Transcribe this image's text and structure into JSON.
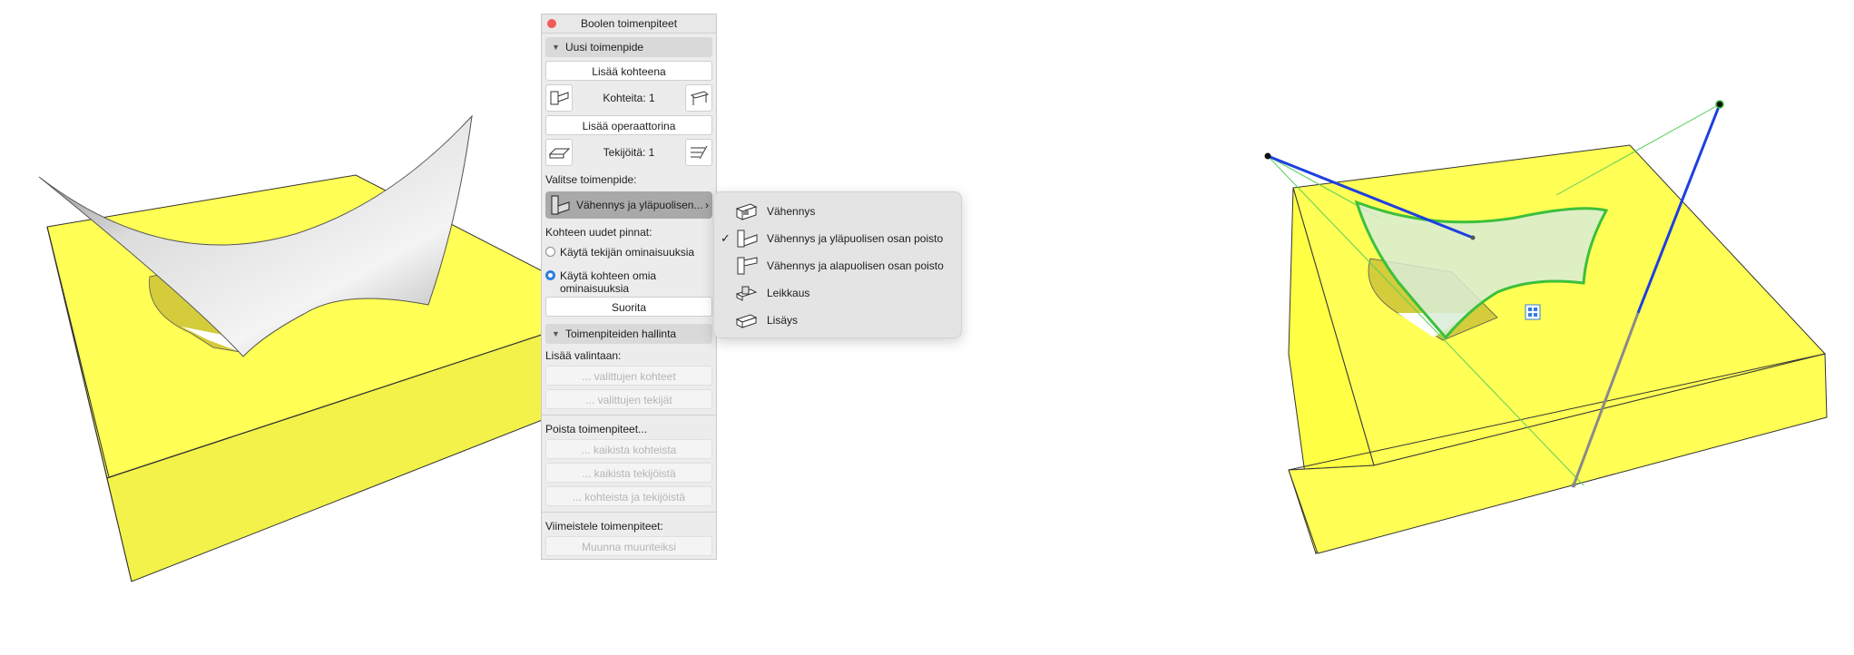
{
  "palette": {
    "title": "Boolen toimenpiteet",
    "section_new": "Uusi toimenpide",
    "add_as_target": "Lisää kohteena",
    "targets_count": "Kohteita: 1",
    "add_as_operator": "Lisää operaattorina",
    "operators_count": "Tekijöitä: 1",
    "choose_operation_label": "Valitse toimenpide:",
    "selected_operation": "Vähennys ja yläpuolisen...",
    "new_surfaces_label": "Kohteen uudet pinnat:",
    "radio_operator_props": "Käytä tekijän ominaisuuksia",
    "radio_target_props": "Käytä kohteen omia ominaisuuksia",
    "execute": "Suorita",
    "section_manage": "Toimenpiteiden hallinta",
    "add_to_selection_label": "Lisää valintaan:",
    "selected_targets": "... valittujen kohteet",
    "selected_operators": "... valittujen tekijät",
    "remove_operations_label": "Poista toimenpiteet...",
    "from_all_targets": "... kaikista kohteista",
    "from_all_operators": "... kaikista tekijöistä",
    "from_targets_and_operators": "... kohteista ja tekijöistä",
    "finalize_label": "Viimeistele toimenpiteet:",
    "convert_to_morph": "Muunna muunteiksi"
  },
  "menu": {
    "items": [
      {
        "label": "Vähennys",
        "checked": false,
        "icon": "subtraction-icon"
      },
      {
        "label": "Vähennys ja yläpuolisen osan poisto",
        "checked": true,
        "icon": "subtraction-upwards-icon"
      },
      {
        "label": "Vähennys ja alapuolisen osan poisto",
        "checked": false,
        "icon": "subtraction-downwards-icon"
      },
      {
        "label": "Leikkaus",
        "checked": false,
        "icon": "intersection-icon"
      },
      {
        "label": "Lisäys",
        "checked": false,
        "icon": "union-icon"
      }
    ],
    "check_glyph": "✓"
  },
  "colors": {
    "slab_yellow": "#ffff55",
    "selection_green": "#3cc03c",
    "editor_blue": "#1f3fe0",
    "radio_accent": "#2f7de1"
  }
}
